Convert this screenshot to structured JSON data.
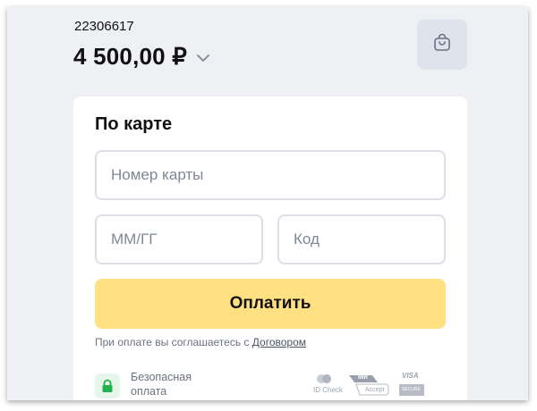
{
  "order": {
    "id": "22306617",
    "amount": "4 500,00 ₽"
  },
  "header": {
    "cart_icon": "shopping-bag-icon",
    "chevron_icon": "chevron-down-icon"
  },
  "form": {
    "title": "По карте",
    "card_number": {
      "value": "",
      "placeholder": "Номер карты"
    },
    "expiry": {
      "value": "",
      "placeholder": "ММ/ГГ"
    },
    "cvc": {
      "value": "",
      "placeholder": "Код"
    },
    "pay_label": "Оплатить",
    "terms_text": "При оплате вы соглашаетесь с ",
    "terms_link": "Договором"
  },
  "footer": {
    "secure_text": "Безопасная оплата",
    "logos": {
      "id_check": "ID Check",
      "mir": "MIR",
      "mir_accept": "Accept",
      "visa": "VISA",
      "visa_secure": "SECURE"
    }
  },
  "colors": {
    "background": "#eef0f4",
    "pay_button": "#ffe083",
    "secure_icon": "#22b14c",
    "field_border": "#dcdfe8"
  }
}
